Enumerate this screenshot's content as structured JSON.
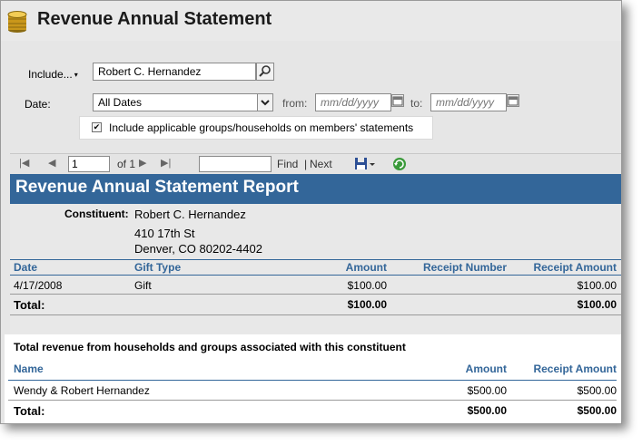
{
  "title": "Revenue Annual Statement",
  "form": {
    "include_label": "Include...",
    "include_value": "Robert C. Hernandez",
    "date_label": "Date:",
    "date_value": "All Dates",
    "from_label": "from:",
    "from_placeholder": "mm/dd/yyyy",
    "to_label": "to:",
    "to_placeholder": "mm/dd/yyyy",
    "checkbox_label": "Include applicable groups/households on members' statements",
    "checkbox_checked": "✔"
  },
  "toolbar": {
    "page": "1",
    "of_label": "of 1",
    "find": "Find",
    "separator": "|",
    "next": "Next"
  },
  "report": {
    "title": "Revenue Annual Statement Report",
    "constituent_label": "Constituent:",
    "name": "Robert C. Hernandez",
    "address_line1": "410 17th St",
    "address_line2": "Denver, CO  80202-4402",
    "columns": {
      "date": "Date",
      "gift_type": "Gift Type",
      "amount": "Amount",
      "receipt_number": "Receipt Number",
      "receipt_amount": "Receipt Amount"
    },
    "rows": [
      {
        "date": "4/17/2008",
        "gift_type": "Gift",
        "amount": "$100.00",
        "receipt_number": "",
        "receipt_amount": "$100.00"
      }
    ],
    "total": {
      "label": "Total:",
      "amount": "$100.00",
      "receipt_amount": "$100.00"
    }
  },
  "associated": {
    "heading": "Total revenue from households and groups associated with this constituent",
    "columns": {
      "name": "Name",
      "amount": "Amount",
      "receipt_amount": "Receipt Amount"
    },
    "rows": [
      {
        "name": "Wendy & Robert Hernandez",
        "amount": "$500.00",
        "receipt_amount": "$500.00"
      }
    ],
    "total": {
      "label": "Total:",
      "amount": "$500.00",
      "receipt_amount": "$500.00"
    }
  },
  "colors": {
    "report_blue": "#336699",
    "panel_grey": "#e6e6e6"
  },
  "icons": [
    "coin-stack-icon",
    "search-icon",
    "dropdown-arrow-icon",
    "calendar-icon",
    "first-page-icon",
    "prev-page-icon",
    "next-page-icon",
    "last-page-icon",
    "save-disk-icon",
    "refresh-icon"
  ]
}
